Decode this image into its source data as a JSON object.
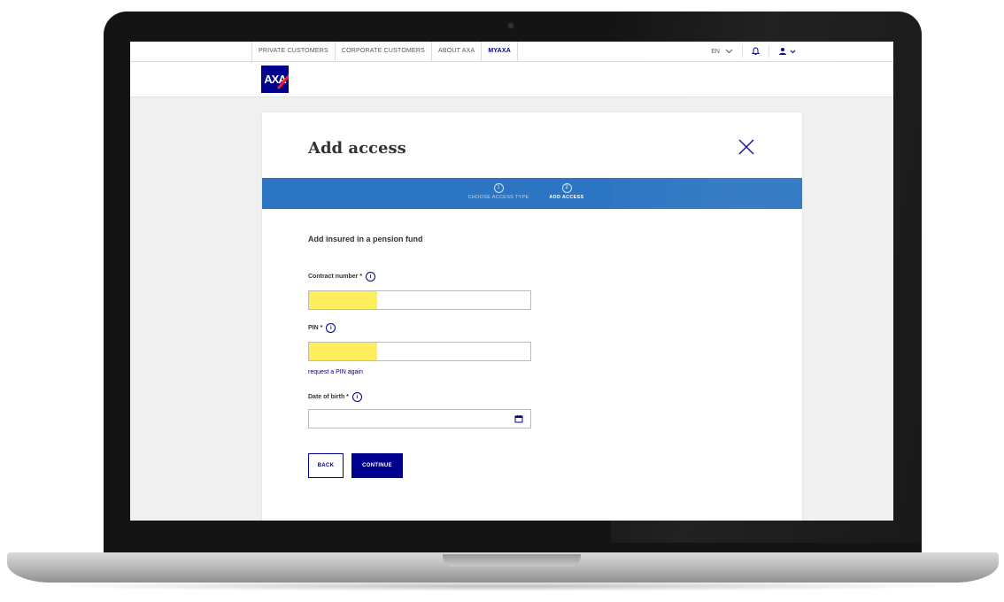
{
  "nav": {
    "tabs": [
      {
        "label": "PRIVATE CUSTOMERS"
      },
      {
        "label": "CORPORATE CUSTOMERS"
      },
      {
        "label": "ABOUT AXA"
      },
      {
        "label": "MYAXA"
      }
    ],
    "language": "EN",
    "logo_text": "AXA"
  },
  "dialog": {
    "title": "Add access",
    "steps": [
      {
        "number": "1",
        "label": "CHOOSE ACCESS TYPE"
      },
      {
        "number": "2",
        "label": "ADD ACCESS"
      }
    ],
    "subtitle": "Add insured in a pension fund",
    "fields": {
      "contract_label": "Contract number *",
      "pin_label": "PIN *",
      "dob_label": "Date of birth *"
    },
    "request_pin_link": "request a PIN again",
    "back_label": "BACK",
    "continue_label": "CONTINUE"
  },
  "colors": {
    "brand": "#00008f",
    "stepper": "#2b75c2",
    "redaction": "#ffee5c",
    "axa_red": "#ff1721"
  },
  "icons": [
    "chevron-down-icon",
    "bell-icon",
    "user-icon",
    "close-icon",
    "info-icon",
    "calendar-icon"
  ]
}
